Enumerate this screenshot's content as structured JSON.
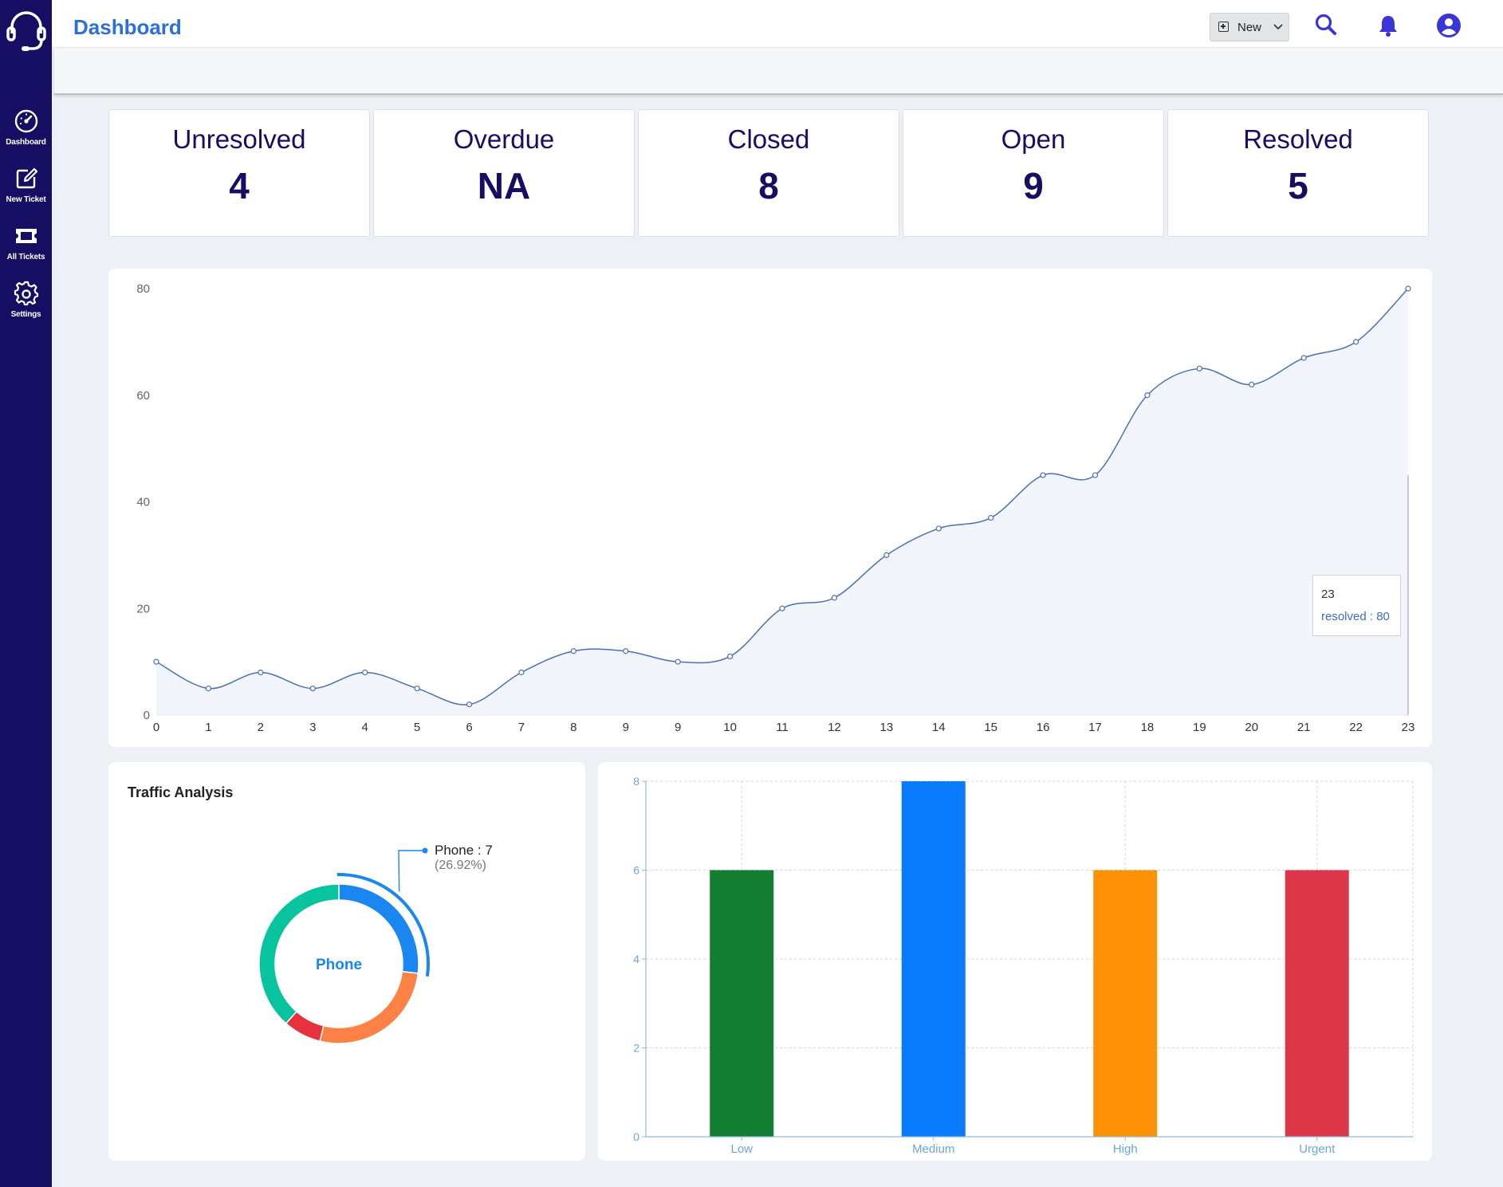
{
  "app": {
    "title": "Dashboard"
  },
  "nav": [
    {
      "label": "Dashboard",
      "icon": "speedometer-icon"
    },
    {
      "label": "New Ticket",
      "icon": "edit-icon"
    },
    {
      "label": "All Tickets",
      "icon": "ticket-icon"
    },
    {
      "label": "Settings",
      "icon": "gear-icon"
    }
  ],
  "header": {
    "new_label": "New",
    "icons": [
      "search-icon",
      "bell-icon",
      "user-icon"
    ]
  },
  "stats": [
    {
      "label": "Unresolved",
      "value": "4"
    },
    {
      "label": "Overdue",
      "value": "NA"
    },
    {
      "label": "Closed",
      "value": "8"
    },
    {
      "label": "Open",
      "value": "9"
    },
    {
      "label": "Resolved",
      "value": "5"
    }
  ],
  "line_tooltip": {
    "x": "23",
    "text": "resolved : 80"
  },
  "traffic": {
    "title": "Traffic Analysis",
    "center_label": "Phone",
    "label_main": "Phone : 7",
    "label_pct": "(26.92%)"
  },
  "colors": {
    "sidebar": "#150e63",
    "accent": "#2c6fd6",
    "line": "#4a6fb5",
    "dark_text": "#150e63"
  },
  "chart_data": [
    {
      "type": "area",
      "series": [
        {
          "name": "resolved",
          "values": [
            10,
            5,
            8,
            5,
            8,
            5,
            2,
            8,
            12,
            12,
            10,
            11,
            20,
            22,
            30,
            35,
            37,
            45,
            45,
            60,
            65,
            62,
            67,
            70,
            80
          ]
        }
      ],
      "x": [
        "0",
        "1",
        "2",
        "3",
        "4",
        "5",
        "6",
        "7",
        "8",
        "9",
        "9",
        "10",
        "11",
        "12",
        "13",
        "14",
        "15",
        "16",
        "17",
        "18",
        "19",
        "20",
        "21",
        "22",
        "23"
      ],
      "yticks": [
        0,
        20,
        40,
        60,
        80
      ],
      "ylim": [
        0,
        80
      ],
      "grid": false
    },
    {
      "type": "pie",
      "title": "Traffic Analysis",
      "slices": [
        {
          "label": "Phone",
          "value": 7,
          "color": "#1a86ef"
        },
        {
          "label": "",
          "value": 7,
          "color": "#fb8144"
        },
        {
          "label": "",
          "value": 2,
          "color": "#e5323e"
        },
        {
          "label": "",
          "value": 10,
          "color": "#08c49e"
        }
      ]
    },
    {
      "type": "bar",
      "categories": [
        "Low",
        "Medium",
        "High",
        "Urgent"
      ],
      "values": [
        6,
        8,
        6,
        6
      ],
      "colors": [
        "#137e31",
        "#0a7bfc",
        "#fd9108",
        "#db3749"
      ],
      "ylim": [
        0,
        8
      ],
      "yticks": [
        0,
        2,
        4,
        6,
        8
      ],
      "grid": true
    }
  ]
}
